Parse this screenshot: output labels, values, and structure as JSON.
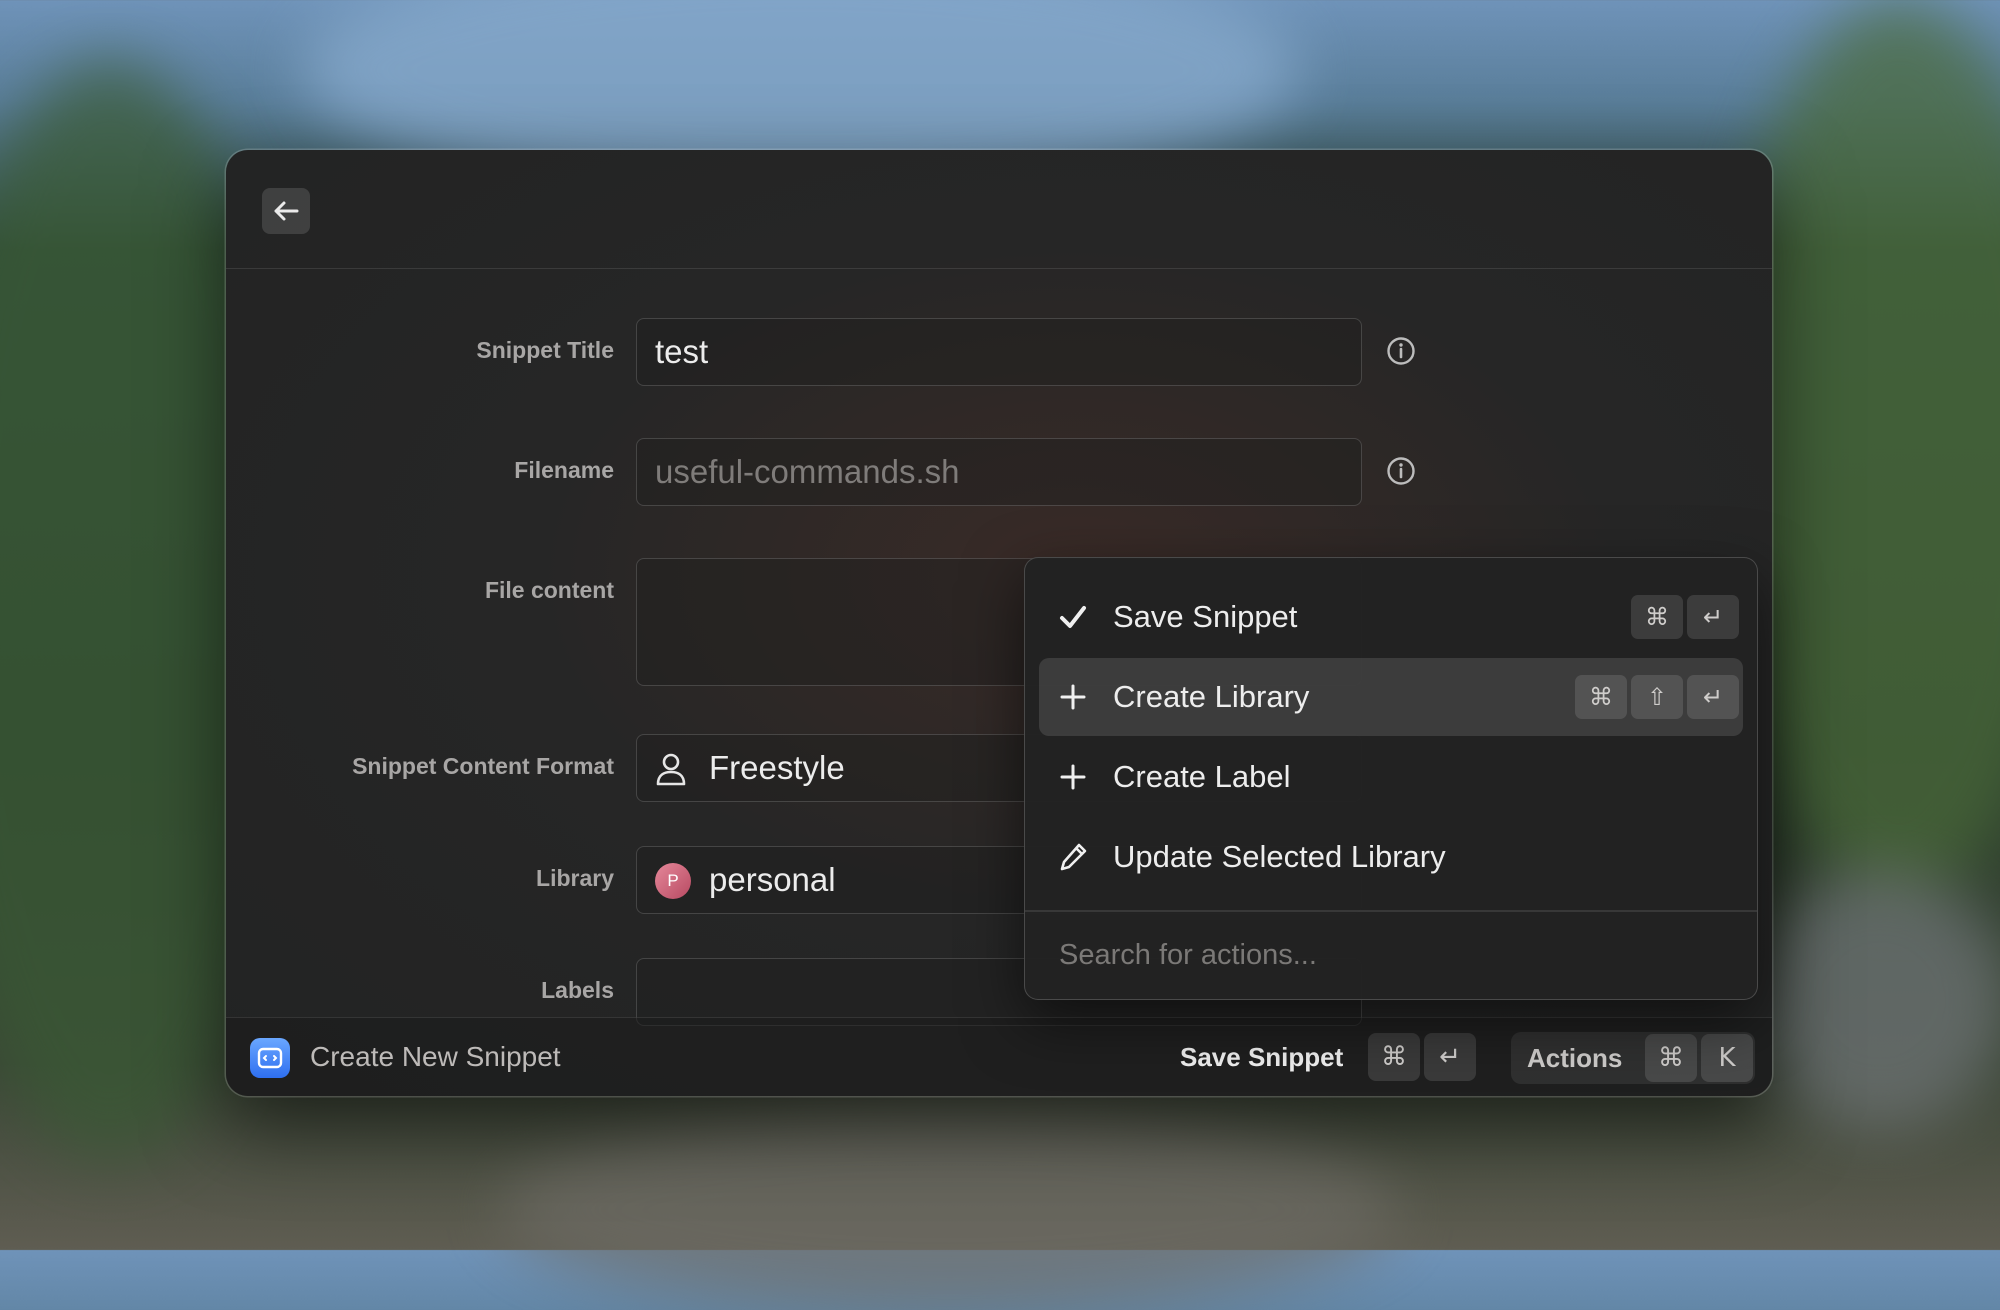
{
  "topbar": {
    "back_icon": "arrow-left-icon"
  },
  "form": {
    "snippet_title": {
      "label": "Snippet Title",
      "value": "test"
    },
    "filename": {
      "label": "Filename",
      "placeholder": "useful-commands.sh"
    },
    "file_content": {
      "label": "File content",
      "value": ""
    },
    "content_format": {
      "label": "Snippet Content Format",
      "value": "Freestyle",
      "icon": "person-icon"
    },
    "library": {
      "label": "Library",
      "value": "personal",
      "avatar_letter": "P"
    },
    "labels": {
      "label": "Labels"
    }
  },
  "footer": {
    "title": "Create New Snippet",
    "primary_action": "Save Snippet",
    "primary_shortcut": [
      "⌘",
      "↵"
    ],
    "actions_label": "Actions",
    "actions_shortcut": [
      "⌘",
      "K"
    ]
  },
  "action_menu": {
    "items": [
      {
        "label": "Save Snippet",
        "icon": "checkmark-icon",
        "shortcut": [
          "⌘",
          "↵"
        ],
        "selected": false
      },
      {
        "label": "Create Library",
        "icon": "plus-icon",
        "shortcut": [
          "⌘",
          "⇧",
          "↵"
        ],
        "selected": true
      },
      {
        "label": "Create Label",
        "icon": "plus-icon",
        "shortcut": [],
        "selected": false
      },
      {
        "label": "Update Selected Library",
        "icon": "pencil-icon",
        "shortcut": [],
        "selected": false
      }
    ],
    "search_placeholder": "Search for actions..."
  },
  "colors": {
    "window_bg": "#252525",
    "accent_app_icon": "#3b7bf5",
    "library_avatar": "#d0687f"
  }
}
